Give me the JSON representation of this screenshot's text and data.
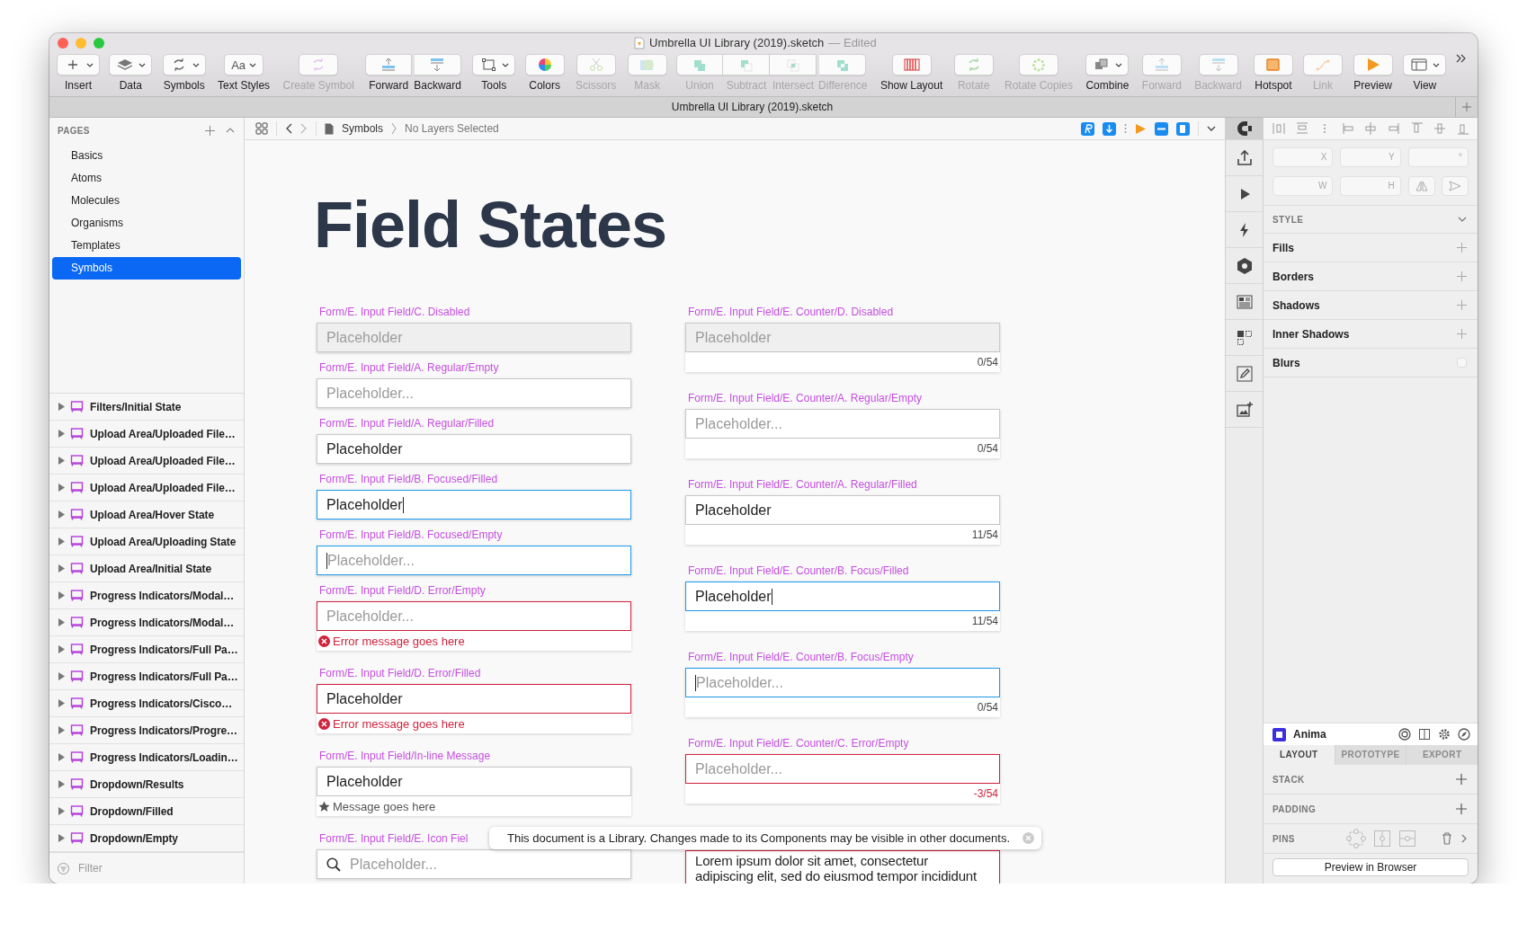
{
  "window": {
    "title": "Umbrella UI Library (2019).sketch",
    "status": "— Edited"
  },
  "toolbar": [
    {
      "dropdown": true,
      "items": [
        {
          "label": "Insert",
          "disabled": false
        }
      ]
    },
    {
      "dropdown": true,
      "items": [
        {
          "label": "Data",
          "disabled": false
        }
      ]
    },
    {
      "dropdown": true,
      "items": [
        {
          "label": "Symbols",
          "disabled": false
        }
      ]
    },
    {
      "dropdown": true,
      "items": [
        {
          "label": "Text Styles",
          "disabled": false,
          "glyph": "Aa"
        }
      ]
    },
    {
      "dropdown": false,
      "items": [
        {
          "label": "Create Symbol",
          "disabled": true
        }
      ]
    },
    {
      "dropdown": false,
      "items": [
        {
          "label": "Forward",
          "disabled": false
        },
        {
          "label": "Backward",
          "disabled": false
        }
      ]
    },
    {
      "dropdown": true,
      "items": [
        {
          "label": "Tools",
          "disabled": false
        }
      ]
    },
    {
      "dropdown": false,
      "items": [
        {
          "label": "Colors",
          "disabled": false
        }
      ]
    },
    {
      "dropdown": false,
      "items": [
        {
          "label": "Scissors",
          "disabled": true
        }
      ]
    },
    {
      "dropdown": false,
      "items": [
        {
          "label": "Mask",
          "disabled": true
        }
      ]
    },
    {
      "dropdown": false,
      "items": [
        {
          "label": "Union",
          "disabled": true
        },
        {
          "label": "Subtract",
          "disabled": true
        },
        {
          "label": "Intersect",
          "disabled": true
        },
        {
          "label": "Difference",
          "disabled": true
        }
      ]
    },
    {
      "dropdown": false,
      "items": [
        {
          "label": "Show Layout",
          "disabled": false
        }
      ]
    },
    {
      "dropdown": false,
      "items": [
        {
          "label": "Rotate",
          "disabled": true
        }
      ]
    },
    {
      "dropdown": false,
      "items": [
        {
          "label": "Rotate Copies",
          "disabled": true
        }
      ]
    },
    {
      "dropdown": true,
      "items": [
        {
          "label": "Combine",
          "disabled": false
        }
      ]
    },
    {
      "dropdown": false,
      "items": [
        {
          "label": "Forward",
          "disabled": true
        }
      ]
    },
    {
      "dropdown": false,
      "items": [
        {
          "label": "Backward",
          "disabled": true
        }
      ]
    },
    {
      "dropdown": false,
      "items": [
        {
          "label": "Hotspot",
          "disabled": false
        }
      ]
    },
    {
      "dropdown": false,
      "items": [
        {
          "label": "Link",
          "disabled": true
        }
      ]
    },
    {
      "dropdown": false,
      "items": [
        {
          "label": "Preview",
          "disabled": false
        }
      ]
    },
    {
      "dropdown": true,
      "items": [
        {
          "label": "View",
          "disabled": false
        }
      ]
    }
  ],
  "tab": {
    "title": "Umbrella UI Library (2019).sketch"
  },
  "pages": {
    "header": "PAGES",
    "items": [
      {
        "label": "Basics",
        "selected": false
      },
      {
        "label": "Atoms",
        "selected": false
      },
      {
        "label": "Molecules",
        "selected": false
      },
      {
        "label": "Organisms",
        "selected": false
      },
      {
        "label": "Templates",
        "selected": false
      },
      {
        "label": "Symbols",
        "selected": true
      }
    ]
  },
  "layers": [
    {
      "label": "Filters/Initial State",
      "expanded": false
    },
    {
      "label": "Upload Area/Uploaded File…",
      "expanded": false
    },
    {
      "label": "Upload Area/Uploaded File…",
      "expanded": false
    },
    {
      "label": "Upload Area/Uploaded File…",
      "expanded": false
    },
    {
      "label": "Upload Area/Hover State",
      "expanded": false
    },
    {
      "label": "Upload Area/Uploading State",
      "expanded": false
    },
    {
      "label": "Upload Area/Initial State",
      "expanded": false
    },
    {
      "label": "Progress Indicators/Modal…",
      "expanded": false
    },
    {
      "label": "Progress Indicators/Modal…",
      "expanded": false
    },
    {
      "label": "Progress Indicators/Full Pa…",
      "expanded": false
    },
    {
      "label": "Progress Indicators/Full Pa…",
      "expanded": false
    },
    {
      "label": "Progress Indicators/Cisco…",
      "expanded": false
    },
    {
      "label": "Progress Indicators/Progre…",
      "expanded": false
    },
    {
      "label": "Progress Indicators/Loadin…",
      "expanded": false
    },
    {
      "label": "Dropdown/Results",
      "expanded": false
    },
    {
      "label": "Dropdown/Filled",
      "expanded": false
    },
    {
      "label": "Dropdown/Empty",
      "expanded": false
    }
  ],
  "filter": {
    "placeholder": "Filter"
  },
  "breadcrumb": {
    "page": "Symbols",
    "selection": "No Layers Selected"
  },
  "canvas": {
    "title": "Field States",
    "columns": [
      [
        {
          "kind": "input",
          "label": "Form/E. Input Field/C. Disabled",
          "disabled": true,
          "focused": false,
          "error": false,
          "placeholder": "Placeholder"
        },
        {
          "kind": "input",
          "label": "Form/E. Input Field/A. Regular/Empty",
          "disabled": false,
          "focused": false,
          "error": false,
          "placeholder": "Placeholder..."
        },
        {
          "kind": "input",
          "label": "Form/E. Input Field/A. Regular/Filled",
          "disabled": false,
          "focused": false,
          "error": false,
          "value": "Placeholder"
        },
        {
          "kind": "input",
          "label": "Form/E. Input Field/B. Focused/Filled",
          "disabled": false,
          "focused": true,
          "error": false,
          "value": "Placeholder"
        },
        {
          "kind": "input",
          "label": "Form/E. Input Field/B. Focused/Empty",
          "disabled": false,
          "focused": true,
          "error": false,
          "placeholder": "Placeholder..."
        },
        {
          "kind": "input",
          "label": "Form/E. Input Field/D. Error/Empty",
          "disabled": false,
          "focused": false,
          "error": true,
          "placeholder": "Placeholder...",
          "message": {
            "kind": "error",
            "text": "Error message goes here"
          }
        },
        {
          "kind": "input",
          "label": "Form/E. Input Field/D. Error/Filled",
          "disabled": false,
          "focused": false,
          "error": true,
          "value": "Placeholder",
          "message": {
            "kind": "error",
            "text": "Error message goes here"
          }
        },
        {
          "kind": "input",
          "label": "Form/E. Input Field/In-line Message",
          "disabled": false,
          "focused": false,
          "error": false,
          "value": "Placeholder",
          "message": {
            "kind": "info",
            "text": "Message goes here"
          }
        },
        {
          "kind": "icon-input",
          "label": "Form/E. Input Field/E. Icon Fiel",
          "disabled": false,
          "focused": false,
          "error": false,
          "placeholder": "Placeholder..."
        }
      ],
      [
        {
          "kind": "input",
          "label": "Form/E. Input Field/E. Counter/D. Disabled",
          "disabled": true,
          "focused": false,
          "error": false,
          "placeholder": "Placeholder",
          "counter": "0/54"
        },
        {
          "kind": "input",
          "label": "Form/E. Input Field/E. Counter/A. Regular/Empty",
          "disabled": false,
          "focused": false,
          "error": false,
          "placeholder": "Placeholder...",
          "counter": "0/54"
        },
        {
          "kind": "input",
          "label": "Form/E. Input Field/E. Counter/A. Regular/Filled",
          "disabled": false,
          "focused": false,
          "error": false,
          "value": "Placeholder",
          "counter": "11/54"
        },
        {
          "kind": "input",
          "label": "Form/E. Input Field/E. Counter/B. Focus/Filled",
          "disabled": false,
          "focused": true,
          "error": false,
          "value": "Placeholder",
          "counter": "11/54"
        },
        {
          "kind": "input",
          "label": "Form/E. Input Field/E. Counter/B. Focus/Empty",
          "disabled": false,
          "focused": true,
          "error": false,
          "placeholder": "Placeholder...",
          "counter": "0/54"
        },
        {
          "kind": "input",
          "label": "Form/E. Input Field/E. Counter/C. Error/Empty",
          "disabled": false,
          "focused": false,
          "error": true,
          "placeholder": "Placeholder...",
          "counter": "-3/54"
        },
        {
          "kind": "textarea",
          "disabled": false,
          "focused": false,
          "error": true,
          "value": "Lorem ipsum dolor sit amet, consectetur\nadipiscing elit, sed do eiusmod tempor incididunt"
        }
      ]
    ]
  },
  "toast": {
    "text": "This document is a Library. Changes made to its Components may be visible in other documents."
  },
  "inspector": {
    "geometry": [
      {
        "label": "X"
      },
      {
        "label": "Y"
      },
      {
        "label": "°"
      },
      {
        "label": "W"
      },
      {
        "label": "H"
      }
    ],
    "style_header": "STYLE",
    "sections": [
      {
        "kind": "add",
        "label": "Fills"
      },
      {
        "kind": "add",
        "label": "Borders"
      },
      {
        "kind": "add",
        "label": "Shadows"
      },
      {
        "kind": "add",
        "label": "Inner Shadows"
      },
      {
        "kind": "toggle",
        "label": "Blurs",
        "checked": false
      }
    ],
    "anima": {
      "title": "Anima",
      "tabs": [
        {
          "label": "LAYOUT",
          "selected": true
        },
        {
          "label": "PROTOTYPE",
          "selected": false
        },
        {
          "label": "EXPORT",
          "selected": false
        }
      ],
      "rows": [
        {
          "kind": "add",
          "label": "STACK"
        },
        {
          "kind": "add",
          "label": "PADDING"
        },
        {
          "kind": "pins",
          "label": "PINS"
        }
      ],
      "button": "Preview in Browser"
    }
  }
}
